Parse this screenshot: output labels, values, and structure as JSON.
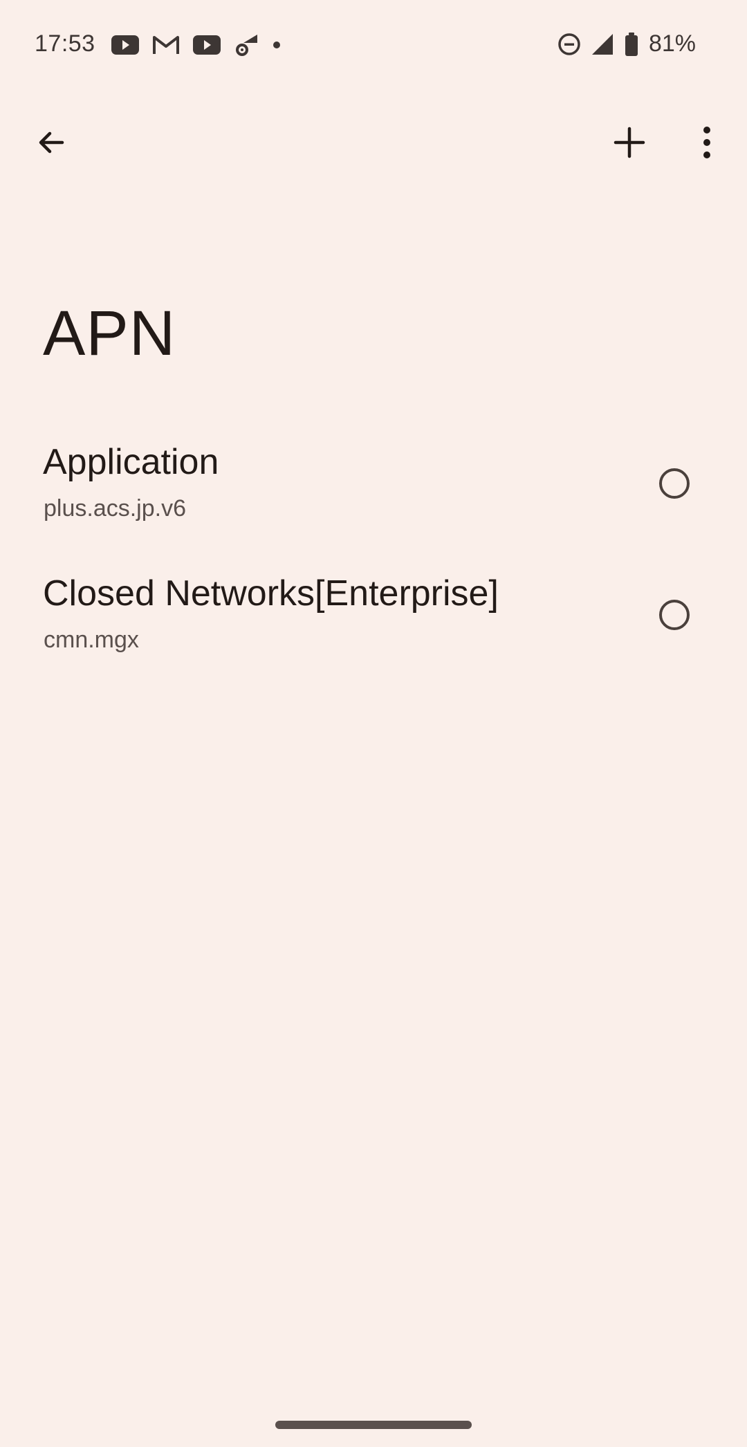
{
  "status_bar": {
    "time": "17:53",
    "notification_icons": [
      "youtube-icon",
      "gmail-icon",
      "youtube-icon",
      "wifi-settings-icon",
      "dot-icon"
    ],
    "system_icons": [
      "do-not-disturb-icon",
      "cellular-signal-icon",
      "battery-icon"
    ],
    "battery_percent": "81%"
  },
  "toolbar": {
    "back_icon": "arrow-back-icon",
    "add_icon": "plus-icon",
    "more_icon": "more-vert-icon"
  },
  "page": {
    "title": "APN"
  },
  "apn_list": [
    {
      "name": "Application",
      "apn": "plus.acs.jp.v6",
      "selected": false
    },
    {
      "name": "Closed Networks[Enterprise]",
      "apn": "cmn.mgx",
      "selected": false
    }
  ],
  "colors": {
    "background": "#faefea",
    "text_primary": "#221a17",
    "text_secondary": "#5a504d"
  }
}
